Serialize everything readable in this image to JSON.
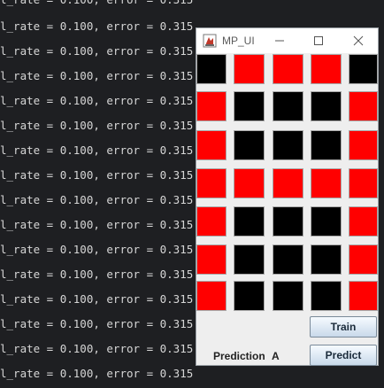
{
  "console": {
    "first_line": "l_rate = 0.100, error = 0.315",
    "lines": [
      "l_rate = 0.100, error = 0.315",
      "l_rate = 0.100, error = 0.315",
      "l_rate = 0.100, error = 0.315",
      "l_rate = 0.100, error = 0.315",
      "l_rate = 0.100, error = 0.315",
      "l_rate = 0.100, error = 0.315",
      "l_rate = 0.100, error = 0.315",
      "l_rate = 0.100, error = 0.315",
      "l_rate = 0.100, error = 0.315",
      "l_rate = 0.100, error = 0.315",
      "l_rate = 0.100, error = 0.315",
      "l_rate = 0.100, error = 0.315",
      "l_rate = 0.100, error = 0.315",
      "l_rate = 0.100, error = 0.315",
      "l_rate = 0.100, error = 0.315"
    ]
  },
  "window": {
    "title": "MP_UI",
    "icons": {
      "app": "java-app-icon",
      "minimize": "minimize-icon",
      "maximize": "maximize-icon",
      "close": "close-icon"
    },
    "grid": {
      "rows": [
        [
          "black",
          "red",
          "red",
          "red",
          "black"
        ],
        [
          "red",
          "black",
          "black",
          "black",
          "red"
        ],
        [
          "red",
          "black",
          "black",
          "black",
          "red"
        ],
        [
          "red",
          "red",
          "red",
          "red",
          "red"
        ],
        [
          "red",
          "black",
          "black",
          "black",
          "red"
        ],
        [
          "red",
          "black",
          "black",
          "black",
          "red"
        ],
        [
          "red",
          "black",
          "black",
          "black",
          "red"
        ]
      ]
    },
    "train_label": "Train",
    "predict_label": "Predict",
    "prediction_label": "Prediction",
    "prediction_value": "A"
  }
}
